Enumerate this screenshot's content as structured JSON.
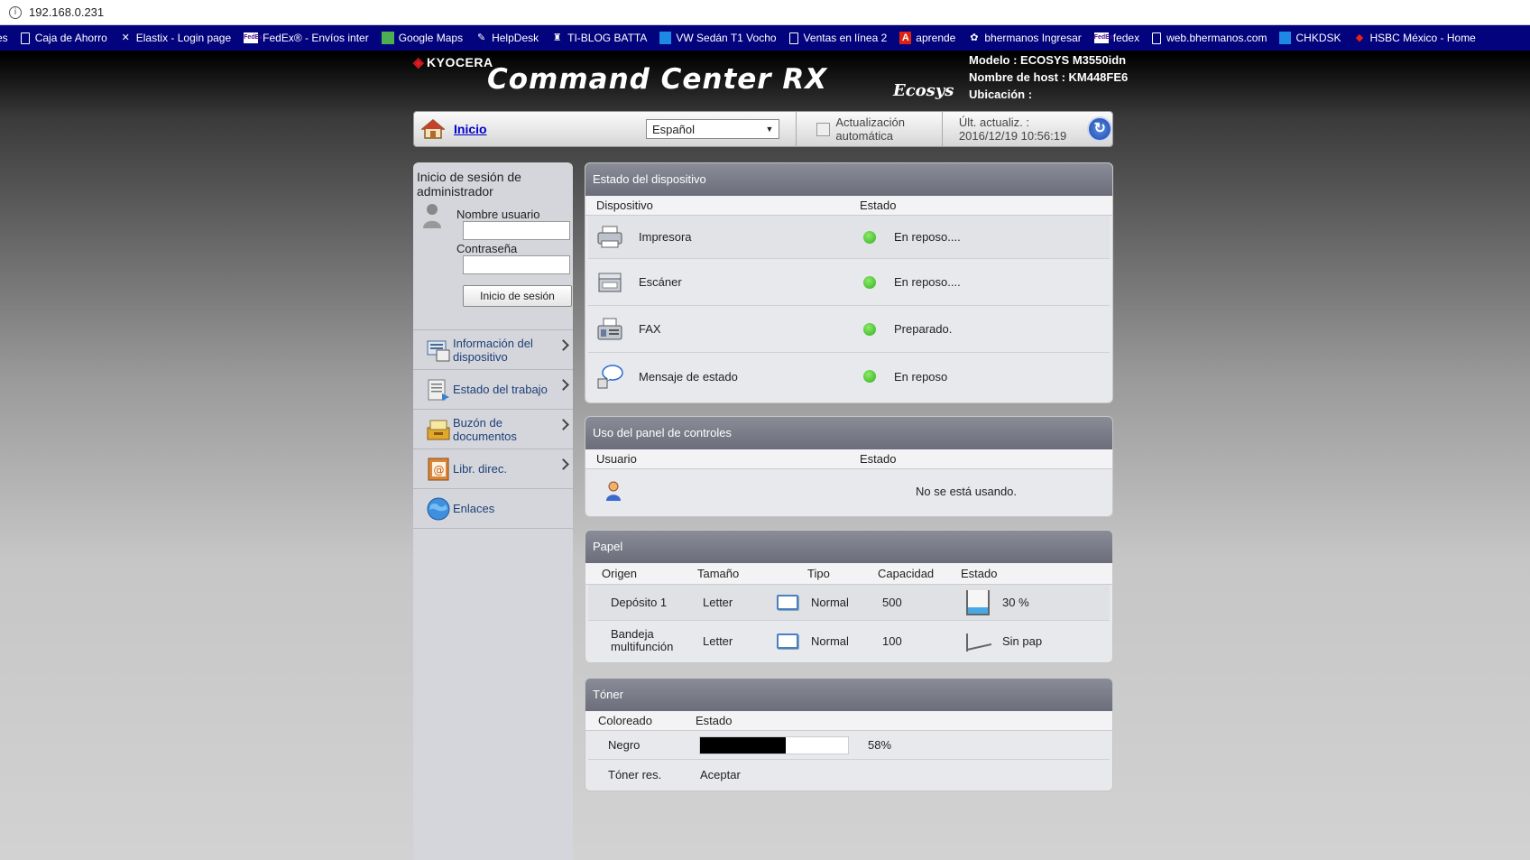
{
  "browser": {
    "url": "192.168.0.231",
    "bookmarks": [
      {
        "label": "es",
        "icon": "bookmark-icon"
      },
      {
        "label": "Caja de Ahorro",
        "icon": "document-icon"
      },
      {
        "label": "Elastix - Login page",
        "icon": "elastix-icon"
      },
      {
        "label": "FedEx® - Envíos inter",
        "icon": "fedex-icon"
      },
      {
        "label": "Google Maps",
        "icon": "maps-icon"
      },
      {
        "label": "HelpDesk",
        "icon": "helpdesk-icon"
      },
      {
        "label": "TI-BLOG BATTA",
        "icon": "blog-icon"
      },
      {
        "label": "VW Sedán T1 Vocho",
        "icon": "car-icon"
      },
      {
        "label": "Ventas en línea 2",
        "icon": "document-icon"
      },
      {
        "label": "aprende",
        "icon": "aprende-icon"
      },
      {
        "label": "bhermanos Ingresar",
        "icon": "bhermanos-icon"
      },
      {
        "label": "fedex",
        "icon": "fedex-icon"
      },
      {
        "label": "web.bhermanos.com",
        "icon": "document-icon"
      },
      {
        "label": "CHKDSK",
        "icon": "chkdsk-icon"
      },
      {
        "label": "HSBC México - Home",
        "icon": "hsbc-icon"
      }
    ]
  },
  "header": {
    "brand": "KYOCERA",
    "product": "Command Center RX",
    "ecosys": "Ecosys",
    "model_line": "Modelo : ECOSYS M3550idn",
    "host_line": "Nombre de host : KM448FE6",
    "location_line": "Ubicación :"
  },
  "topbar": {
    "home_label": "Inicio",
    "language": "Español",
    "auto_update_line1": "Actualización",
    "auto_update_line2": "automática",
    "last_update_line1": "Últ. actualiz. :",
    "last_update_line2": "2016/12/19 10:56:19"
  },
  "sidebar": {
    "login_title": "Inicio de sesión de administrador",
    "username_label": "Nombre usuario",
    "password_label": "Contraseña",
    "login_button": "Inicio de sesión",
    "items": [
      {
        "label": "Información del dispositivo",
        "icon": "device-info-icon"
      },
      {
        "label": "Estado del trabajo",
        "icon": "job-status-icon"
      },
      {
        "label": "Buzón de documentos",
        "icon": "document-box-icon"
      },
      {
        "label": "Libr. direc.",
        "icon": "address-book-icon"
      },
      {
        "label": "Enlaces",
        "icon": "globe-icon"
      }
    ]
  },
  "device_status": {
    "title": "Estado del dispositivo",
    "col_device": "Dispositivo",
    "col_status": "Estado",
    "rows": [
      {
        "device": "Impresora",
        "status": "En reposo....",
        "icon": "printer-icon"
      },
      {
        "device": "Escáner",
        "status": "En reposo....",
        "icon": "scanner-icon"
      },
      {
        "device": "FAX",
        "status": "Preparado.",
        "icon": "fax-icon"
      },
      {
        "device": "Mensaje de estado",
        "status": "En reposo",
        "icon": "status-message-icon"
      }
    ],
    "status_color": "#2fb21e"
  },
  "panel_usage": {
    "title": "Uso del panel de controles",
    "col_user": "Usuario",
    "col_status": "Estado",
    "status": "No se está usando."
  },
  "paper": {
    "title": "Papel",
    "columns": [
      "Origen",
      "Tamaño",
      "Tipo",
      "Capacidad",
      "Estado"
    ],
    "rows": [
      {
        "source": "Depósito 1",
        "size": "Letter",
        "type": "Normal",
        "capacity": "500",
        "status": "30 %",
        "level": 0.3
      },
      {
        "source": "Bandeja multifunción",
        "size": "Letter",
        "type": "Normal",
        "capacity": "100",
        "status": "Sin pap",
        "level": 0
      }
    ]
  },
  "toner": {
    "title": "Tóner",
    "col_color": "Coloreado",
    "col_status": "Estado",
    "color": "Negro",
    "percent_text": "58%",
    "level": 0.58,
    "remaining_label": "Tóner res.",
    "remaining_value": "Aceptar"
  }
}
